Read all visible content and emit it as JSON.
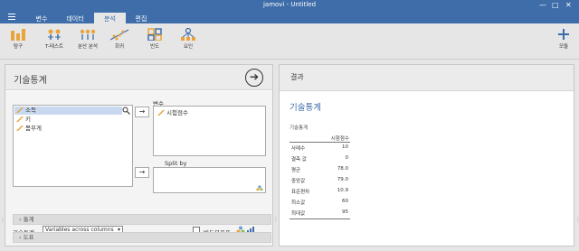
{
  "window": {
    "title": "jamovi - Untitled",
    "minimize": "—",
    "maximize": "□",
    "close": "✕"
  },
  "menu": {
    "tabs": [
      {
        "label": "변수"
      },
      {
        "label": "데이터"
      },
      {
        "label": "분석"
      },
      {
        "label": "편집"
      }
    ],
    "active_tab": "분석"
  },
  "ribbon": {
    "buttons": [
      {
        "label": "탐구",
        "icon": "bar-chart-icon"
      },
      {
        "label": "T-테스트",
        "icon": "t-test-icon"
      },
      {
        "label": "분산 분석",
        "icon": "anova-icon"
      },
      {
        "label": "회귀",
        "icon": "regression-icon"
      },
      {
        "label": "빈도",
        "icon": "frequencies-icon"
      },
      {
        "label": "요인",
        "icon": "factor-icon"
      }
    ],
    "modules_label": "모듈"
  },
  "analysis_panel": {
    "title": "기술통계",
    "variables_available": [
      {
        "name": "소득",
        "selected": true
      },
      {
        "name": "키",
        "selected": false
      },
      {
        "name": "몸무게",
        "selected": false
      }
    ],
    "variables_label": "변수",
    "variables_selected": [
      "시험점수"
    ],
    "split_by_label": "Split by",
    "desc_label": "기술통계",
    "desc_option": "Variables across columns",
    "freq_table_label": "빈도분포표",
    "sections": [
      {
        "label": "통계"
      },
      {
        "label": "도표"
      }
    ]
  },
  "results": {
    "header": "결과",
    "title": "기술통계",
    "table_caption": "기술통계",
    "column_header": "시험점수",
    "rows": [
      {
        "label": "사례수",
        "value": "10"
      },
      {
        "label": "결측 값",
        "value": "0"
      },
      {
        "label": "평균",
        "value": "78.0"
      },
      {
        "label": "중앙값",
        "value": "79.0"
      },
      {
        "label": "표준편차",
        "value": "10.9"
      },
      {
        "label": "최소값",
        "value": "60"
      },
      {
        "label": "최대값",
        "value": "95"
      }
    ]
  },
  "colors": {
    "accent": "#3e6da9",
    "selected_row": "#c8d8ee",
    "pencil": "#e8a43b"
  }
}
